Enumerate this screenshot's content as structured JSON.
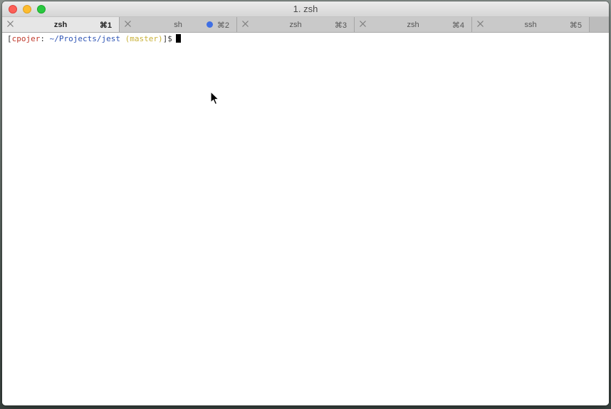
{
  "window": {
    "title": "1. zsh"
  },
  "tabs": [
    {
      "label": "zsh",
      "shortcut": "⌘1",
      "active": true,
      "activity": false
    },
    {
      "label": "sh",
      "shortcut": "⌘2",
      "active": false,
      "activity": true
    },
    {
      "label": "zsh",
      "shortcut": "⌘3",
      "active": false,
      "activity": false
    },
    {
      "label": "zsh",
      "shortcut": "⌘4",
      "active": false,
      "activity": false
    },
    {
      "label": "ssh",
      "shortcut": "⌘5",
      "active": false,
      "activity": false
    }
  ],
  "terminal": {
    "prompt": {
      "open_bracket": "[",
      "user": "cpojer",
      "separator": ": ",
      "path": "~/Projects/jest",
      "branch": " (master)",
      "close_bracket": "]",
      "symbol": "$"
    }
  },
  "colors": {
    "prompt_user": "#c0392b",
    "prompt_path": "#2f55b5",
    "prompt_branch": "#c9b23a",
    "prompt_plain": "#333333",
    "activity_dot": "#3f6fe4"
  },
  "icons": {
    "tab_close": "close-icon",
    "activity": "activity-dot-icon",
    "pointer": "mouse-pointer-icon"
  }
}
